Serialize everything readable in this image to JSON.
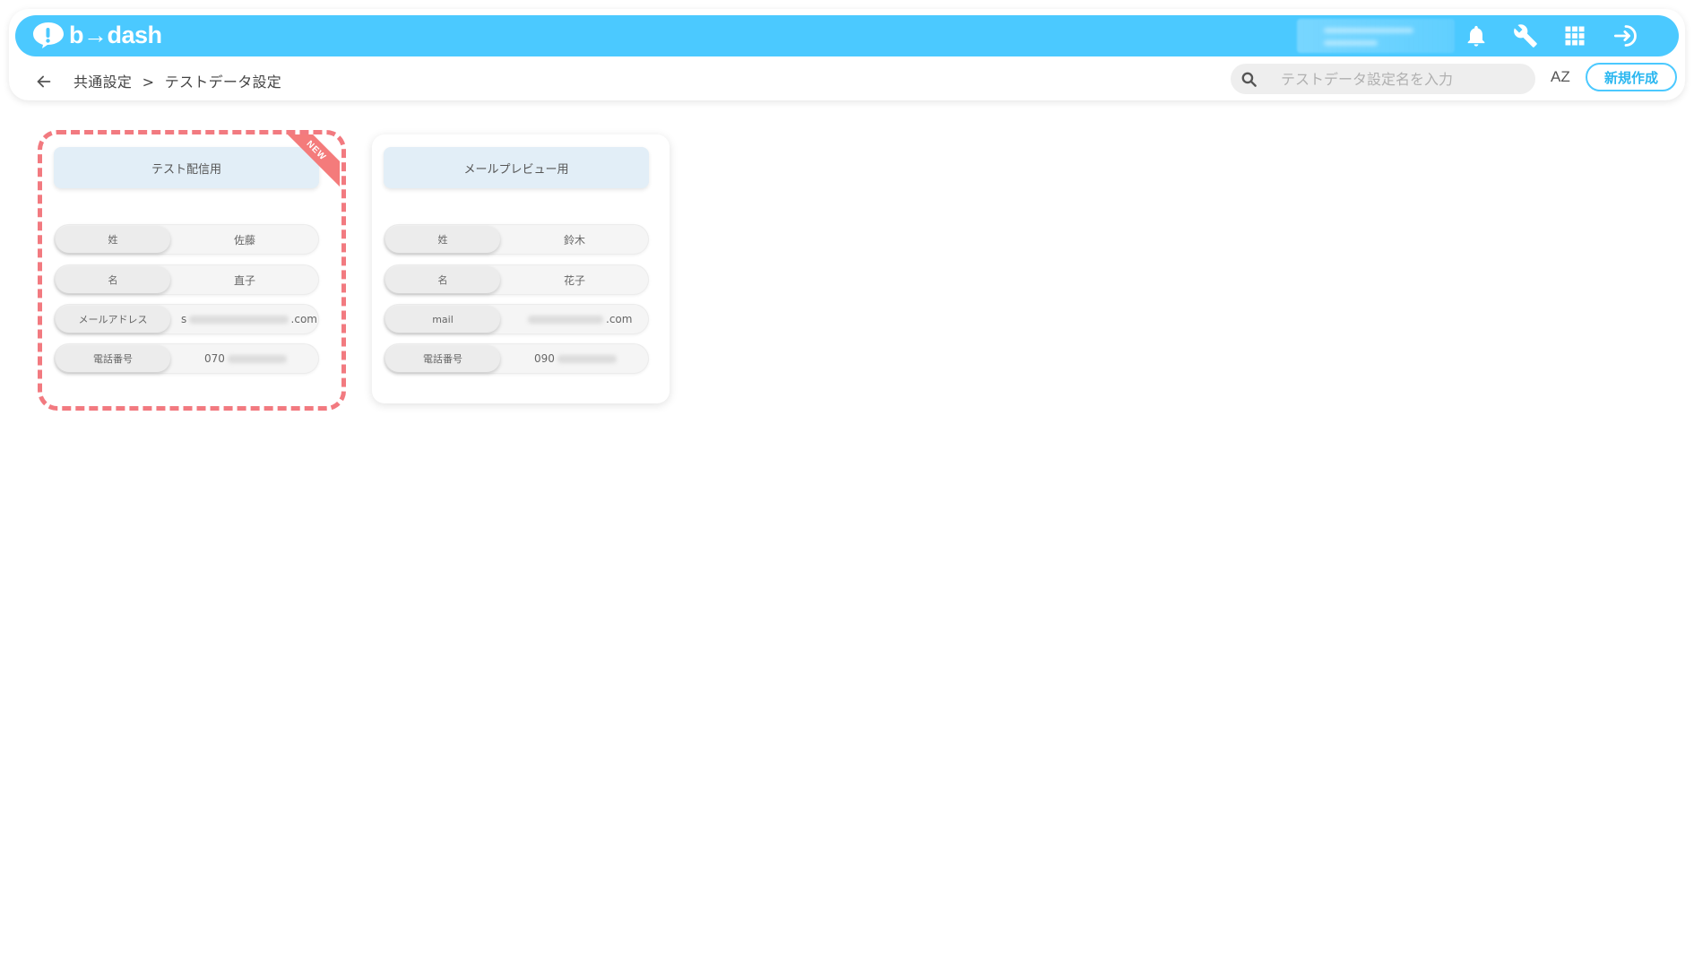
{
  "header": {
    "logo_text": "b→dash",
    "icons": [
      "bell-icon",
      "wrench-icon",
      "apps-grid-icon",
      "logout-icon"
    ]
  },
  "breadcrumb": {
    "items": [
      "共通設定",
      ">",
      "テストデータ設定"
    ]
  },
  "search": {
    "placeholder": "テストデータ設定名を入力"
  },
  "toolbar": {
    "sort_label": "AZ",
    "new_label": "新規作成"
  },
  "cards": [
    {
      "title": "テスト配信用",
      "badge": "NEW",
      "fields": [
        {
          "label": "姓",
          "value": "佐藤"
        },
        {
          "label": "名",
          "value": "直子"
        },
        {
          "label": "メールアドレス",
          "value_prefix": "s",
          "value_suffix": ".com"
        },
        {
          "label": "電話番号",
          "value_prefix": "070"
        }
      ]
    },
    {
      "title": "メールプレビュー用",
      "fields": [
        {
          "label": "姓",
          "value": "鈴木"
        },
        {
          "label": "名",
          "value": "花子"
        },
        {
          "label": "mail",
          "value_suffix": ".com"
        },
        {
          "label": "電話番号",
          "value_prefix": "090"
        }
      ]
    }
  ],
  "colors": {
    "brand": "#4bc9ff",
    "highlight": "#f27a80",
    "card_title_bg": "#e2eef7"
  }
}
